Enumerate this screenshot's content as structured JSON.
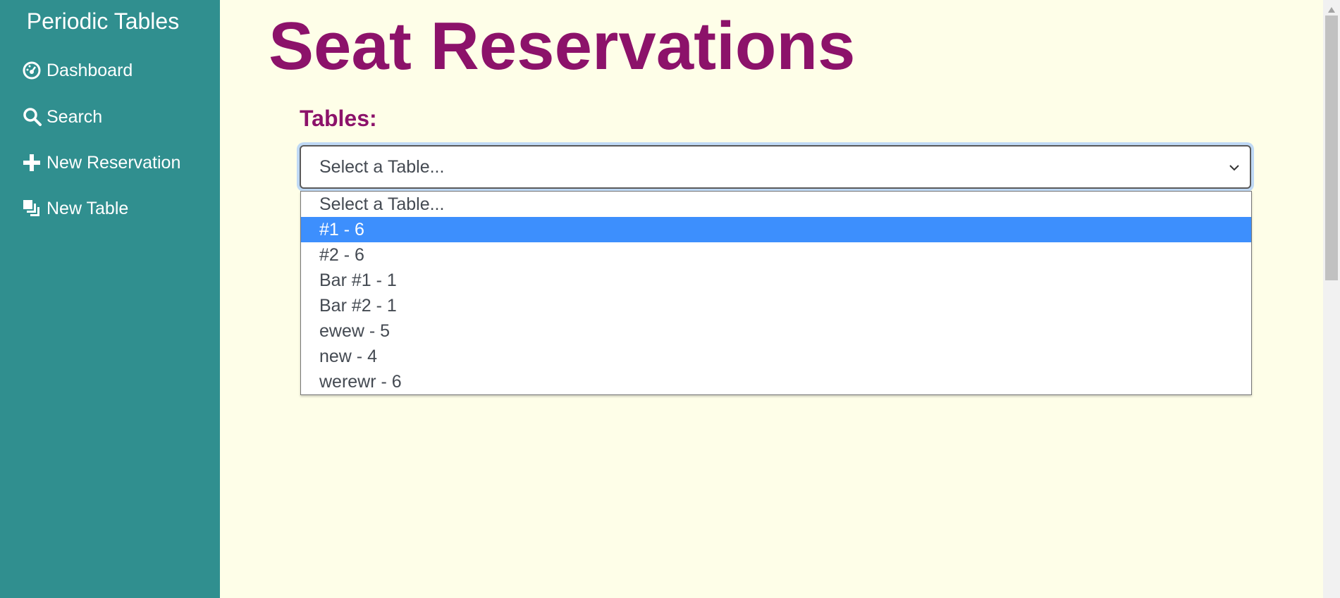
{
  "sidebar": {
    "brand": "Periodic Tables",
    "items": [
      {
        "label": "Dashboard",
        "icon": "dashboard-icon"
      },
      {
        "label": "Search",
        "icon": "search-icon"
      },
      {
        "label": "New Reservation",
        "icon": "plus-icon"
      },
      {
        "label": "New Table",
        "icon": "layers-icon"
      }
    ]
  },
  "main": {
    "title": "Seat Reservations",
    "tables_label": "Tables:",
    "select": {
      "value": "Select a Table...",
      "options": [
        "Select a Table...",
        "#1 - 6",
        "#2 - 6",
        "Bar #1 - 1",
        "Bar #2 - 1",
        "ewew - 5",
        "new - 4",
        "werewr - 6"
      ],
      "highlighted_option": "#1 - 6"
    }
  },
  "colors": {
    "sidebar": "#308f8f",
    "background": "#fefee8",
    "accent": "#8c126a",
    "highlight": "#3d8ffd"
  }
}
